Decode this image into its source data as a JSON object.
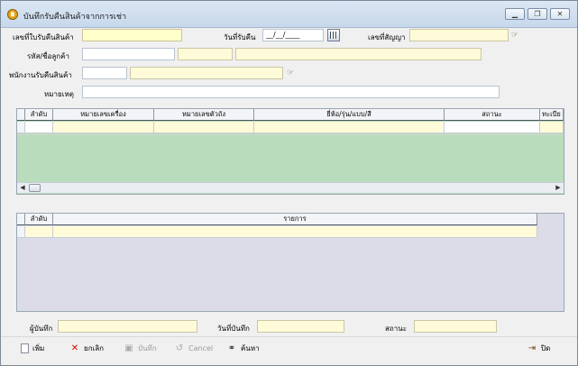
{
  "window": {
    "title": "บันทึกรับคืนสินค้าจากการเช่า",
    "minimize": "▁",
    "restore": "❐",
    "close": "✕"
  },
  "form": {
    "receipt_no_label": "เลขที่ใบรับคืนสินค้า",
    "receipt_no_value": "",
    "receive_date_label": "วันที่รับคืน",
    "receive_date_value": "__/__/____",
    "contract_no_label": "เลขที่สัญญา",
    "contract_no_value": "",
    "customer_label": "รหัส/ชื่อลูกค้า",
    "customer_code": "",
    "customer_extra": "",
    "customer_name": "",
    "staff_label": "พนักงานรับคืนสินค้า",
    "staff_code": "",
    "staff_name": "",
    "remark_label": "หมายเหตุ",
    "remark_value": ""
  },
  "items_grid": {
    "columns": [
      "ลำดับ",
      "หมายเลขเครื่อง",
      "หมายเลขตัวถัง",
      "ยี่ห้อ/รุ่น/แบบ/สี",
      "สถานะ",
      "ทะเบีย"
    ]
  },
  "details_grid": {
    "columns": [
      "ลำดับ",
      "รายการ"
    ]
  },
  "footer": {
    "recorder_label": "ผู้บันทึก",
    "recorder_value": "",
    "record_date_label": "วันที่บันทึก",
    "record_date_value": "",
    "status_label": "สถานะ",
    "status_value": ""
  },
  "toolbar": {
    "add": "เพิ่ม",
    "cancel_th": "ยกเลิก",
    "save": "บันทึก",
    "cancel_en": "Cancel",
    "search": "ค้นหา",
    "close": "ปิด"
  },
  "colors": {
    "grid_green": "#b9dcbc",
    "grid_lavender": "#dcdce9",
    "field_yellow": "#fffbd8"
  }
}
